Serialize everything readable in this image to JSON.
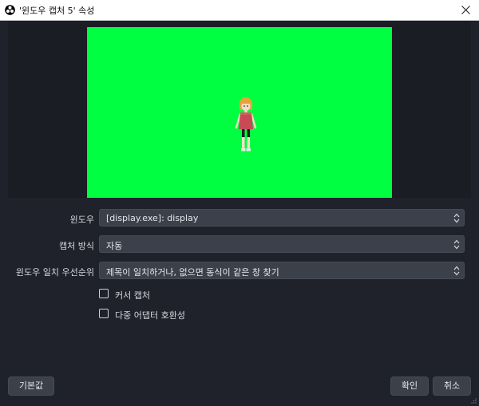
{
  "window": {
    "title": "'윈도우 캡처 5' 속성",
    "app_icon": "obs-logo-icon",
    "close_icon": "close-icon"
  },
  "preview": {
    "background_color": "#00ff41"
  },
  "form": {
    "window_label": "윈도우",
    "window_value": "[display.exe]: display",
    "capture_method_label": "캡처 방식",
    "capture_method_value": "자동",
    "priority_label": "윈도우 일치 우선순위",
    "priority_value": "제목이 일치하거나, 없으면 동식이 같은 창 찾기",
    "cursor_capture_label": "커서 캡처",
    "cursor_capture_checked": false,
    "multi_adapter_label": "다중 어댑터 호환성",
    "multi_adapter_checked": false
  },
  "buttons": {
    "defaults": "기본값",
    "ok": "확인",
    "cancel": "취소"
  }
}
